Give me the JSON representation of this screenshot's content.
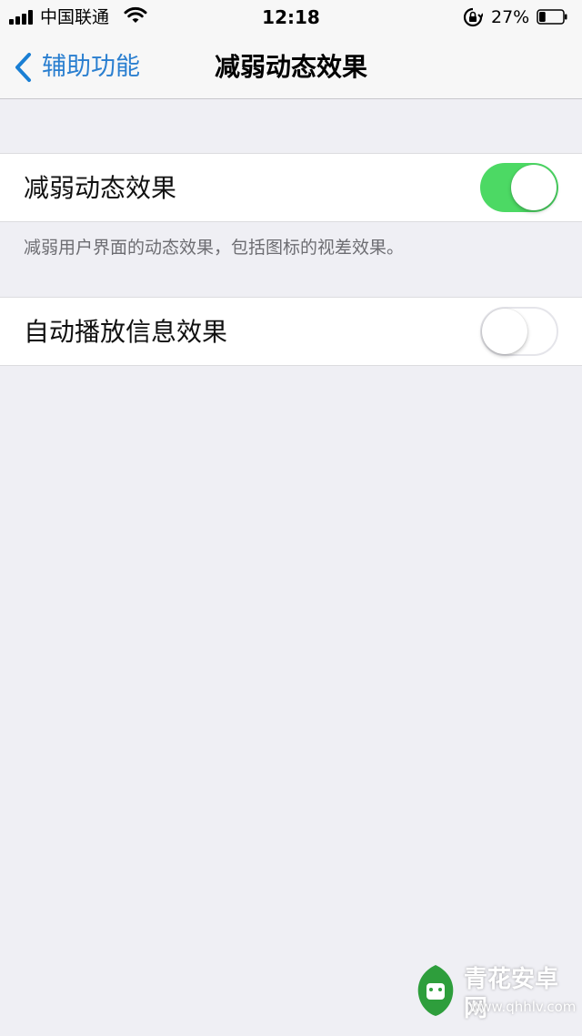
{
  "status_bar": {
    "carrier": "中国联通",
    "time": "12:18",
    "battery_percent": "27%",
    "battery_level": 0.27,
    "icons": [
      "signal-icon",
      "wifi-icon",
      "orientation-lock-icon",
      "battery-icon"
    ]
  },
  "nav": {
    "back_label": "辅助功能",
    "title": "减弱动态效果"
  },
  "settings": [
    {
      "label": "减弱动态效果",
      "enabled": true
    },
    {
      "label": "自动播放信息效果",
      "enabled": false
    }
  ],
  "footer_note": "减弱用户界面的动态效果，包括图标的视差效果。",
  "watermark": {
    "name": "青花安卓网",
    "url": "www.qhhlv.com"
  },
  "colors": {
    "accent": "#1a7fd4",
    "toggle_on": "#4cd964",
    "background": "#efeff4"
  }
}
